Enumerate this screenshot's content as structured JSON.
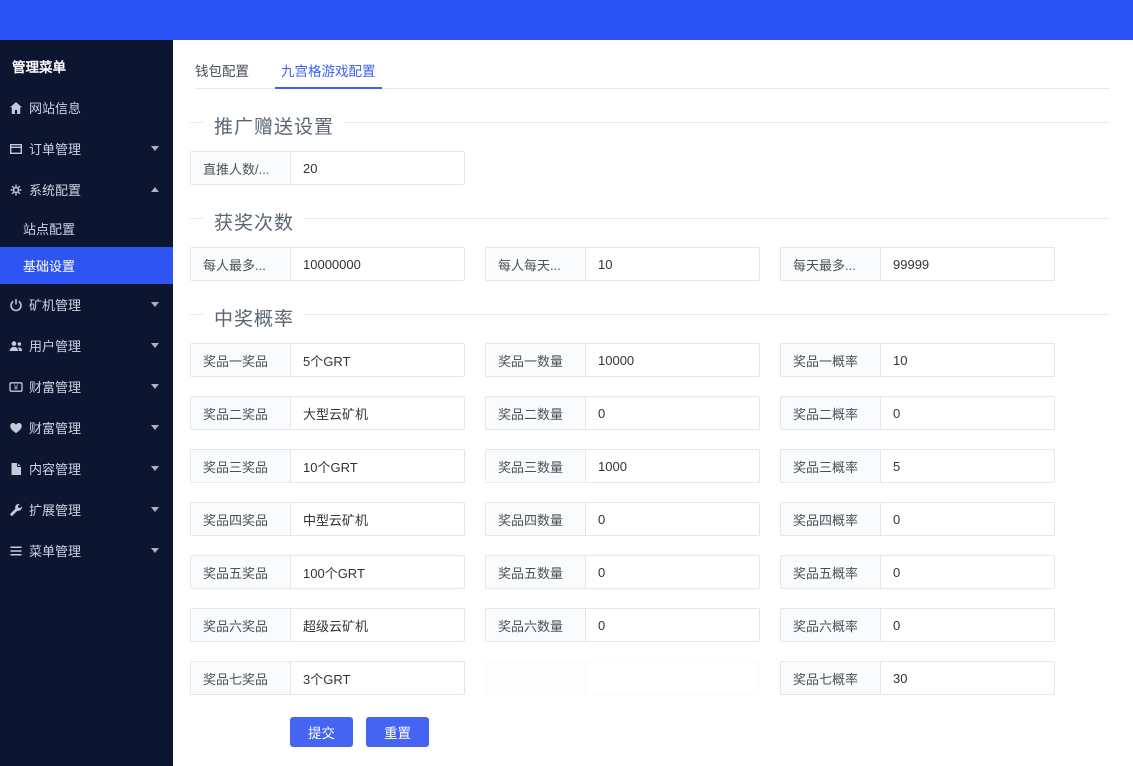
{
  "topbar": {},
  "sidebar": {
    "title": "管理菜单",
    "items": [
      {
        "label": "网站信息",
        "icon": "home-icon",
        "arrow": null
      },
      {
        "label": "订单管理",
        "icon": "order-icon",
        "arrow": "down"
      },
      {
        "label": "系统配置",
        "icon": "gears-icon",
        "arrow": "up",
        "expanded": true,
        "children": [
          {
            "label": "站点配置",
            "active": false
          },
          {
            "label": "基础设置",
            "active": true
          }
        ]
      },
      {
        "label": "矿机管理",
        "icon": "power-icon",
        "arrow": "down"
      },
      {
        "label": "用户管理",
        "icon": "users-icon",
        "arrow": "down"
      },
      {
        "label": "财富管理",
        "icon": "money-icon",
        "arrow": "down"
      },
      {
        "label": "财富管理",
        "icon": "heart-icon",
        "arrow": "down"
      },
      {
        "label": "内容管理",
        "icon": "document-icon",
        "arrow": "down"
      },
      {
        "label": "扩展管理",
        "icon": "wrench-icon",
        "arrow": "down"
      },
      {
        "label": "菜单管理",
        "icon": "menu-icon",
        "arrow": "down"
      }
    ]
  },
  "tabs": [
    {
      "label": "钱包配置",
      "active": false
    },
    {
      "label": "九宫格游戏配置",
      "active": true
    }
  ],
  "sections": [
    {
      "title": "推广赠送设置",
      "rows": [
        [
          {
            "name": "direct-referral-count",
            "label": "直推人数/...",
            "value": "20"
          }
        ]
      ]
    },
    {
      "title": "获奖次数",
      "rows": [
        [
          {
            "name": "max-per-person",
            "label": "每人最多...",
            "value": "10000000"
          },
          {
            "name": "per-person-per-day",
            "label": "每人每天...",
            "value": "10"
          },
          {
            "name": "max-per-day",
            "label": "每天最多...",
            "value": "99999"
          }
        ]
      ]
    },
    {
      "title": "中奖概率",
      "rows": [
        [
          {
            "name": "prize1-item",
            "label": "奖品一奖品",
            "value": "5个GRT"
          },
          {
            "name": "prize1-qty",
            "label": "奖品一数量",
            "value": "10000"
          },
          {
            "name": "prize1-prob",
            "label": "奖品一概率",
            "value": "10"
          }
        ],
        [
          {
            "name": "prize2-item",
            "label": "奖品二奖品",
            "value": "大型云矿机"
          },
          {
            "name": "prize2-qty",
            "label": "奖品二数量",
            "value": "0"
          },
          {
            "name": "prize2-prob",
            "label": "奖品二概率",
            "value": "0"
          }
        ],
        [
          {
            "name": "prize3-item",
            "label": "奖品三奖品",
            "value": "10个GRT"
          },
          {
            "name": "prize3-qty",
            "label": "奖品三数量",
            "value": "1000"
          },
          {
            "name": "prize3-prob",
            "label": "奖品三概率",
            "value": "5"
          }
        ],
        [
          {
            "name": "prize4-item",
            "label": "奖品四奖品",
            "value": "中型云矿机"
          },
          {
            "name": "prize4-qty",
            "label": "奖品四数量",
            "value": "0"
          },
          {
            "name": "prize4-prob",
            "label": "奖品四概率",
            "value": "0"
          }
        ],
        [
          {
            "name": "prize5-item",
            "label": "奖品五奖品",
            "value": "100个GRT"
          },
          {
            "name": "prize5-qty",
            "label": "奖品五数量",
            "value": "0"
          },
          {
            "name": "prize5-prob",
            "label": "奖品五概率",
            "value": "0"
          }
        ],
        [
          {
            "name": "prize6-item",
            "label": "奖品六奖品",
            "value": "超级云矿机"
          },
          {
            "name": "prize6-qty",
            "label": "奖品六数量",
            "value": "0"
          },
          {
            "name": "prize6-prob",
            "label": "奖品六概率",
            "value": "0"
          }
        ],
        [
          {
            "name": "prize7-item",
            "label": "奖品七奖品",
            "value": "3个GRT"
          },
          {
            "name": "prize7-qty",
            "label": "",
            "value": "",
            "obscured": true
          },
          {
            "name": "prize7-prob",
            "label": "奖品七概率",
            "value": "30"
          }
        ]
      ]
    }
  ],
  "buttons": {
    "submit": "提交",
    "reset": "重置"
  },
  "colors": {
    "topbar": "#2b52f5",
    "sidebar_bg": "#0d1631",
    "active_item": "#2e55f2",
    "tab_accent": "#3b60f6",
    "button": "#4464f1"
  }
}
